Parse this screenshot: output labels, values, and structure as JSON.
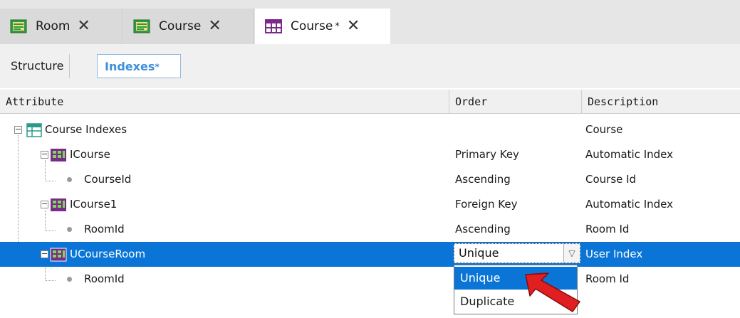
{
  "tabs": [
    {
      "label": "Room",
      "close": "✕",
      "type": "transaction"
    },
    {
      "label": "Course",
      "close": "✕",
      "type": "transaction"
    },
    {
      "label": "Course",
      "dirty_mark": "*",
      "close": "✕",
      "type": "table"
    }
  ],
  "subtabs": {
    "structure": "Structure",
    "indexes": "Indexes",
    "indexes_dirty": "*"
  },
  "grid": {
    "columns": {
      "attribute": "Attribute",
      "order": "Order",
      "description": "Description"
    },
    "rows": [
      {
        "attribute": "Course Indexes",
        "order": "",
        "description": "Course",
        "level": 0,
        "kind": "indexes-root"
      },
      {
        "attribute": "ICourse",
        "order": "Primary Key",
        "description": "Automatic Index",
        "level": 1,
        "kind": "index"
      },
      {
        "attribute": "CourseId",
        "order": "Ascending",
        "description": "Course Id",
        "level": 2,
        "kind": "attribute"
      },
      {
        "attribute": "ICourse1",
        "order": "Foreign Key",
        "description": "Automatic Index",
        "level": 1,
        "kind": "index"
      },
      {
        "attribute": "RoomId",
        "order": "Ascending",
        "description": "Room Id",
        "level": 2,
        "kind": "attribute"
      },
      {
        "attribute": "UCourseRoom",
        "order": "Unique",
        "description": "User Index",
        "level": 1,
        "kind": "index",
        "selected": true
      },
      {
        "attribute": "RoomId",
        "order": "",
        "description": "Room Id",
        "level": 2,
        "kind": "attribute"
      }
    ]
  },
  "order_dropdown": {
    "value": "Unique",
    "options": [
      "Unique",
      "Duplicate"
    ],
    "highlighted": "Unique"
  },
  "colors": {
    "selection": "#0a75d6",
    "accent_tab": "#3c8fd9",
    "arrow": "#e02020"
  }
}
